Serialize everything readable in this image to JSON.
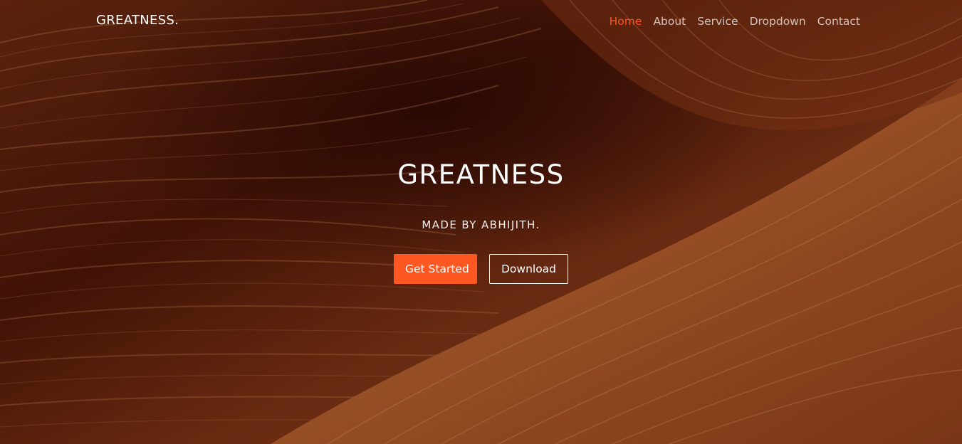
{
  "brand": {
    "name": "GREATNESS.",
    "accent_color": "#ff5721"
  },
  "nav": {
    "items": [
      {
        "label": "Home",
        "active": true
      },
      {
        "label": "About",
        "active": false
      },
      {
        "label": "Service",
        "active": false
      },
      {
        "label": "Dropdown",
        "active": false
      },
      {
        "label": "Contact",
        "active": false
      }
    ]
  },
  "hero": {
    "title": "GREATNESS",
    "subtitle": "MADE BY ABHIJITH.",
    "primary_button": "Get Started",
    "secondary_button": "Download",
    "background": "sandstone-canyon-photo"
  }
}
